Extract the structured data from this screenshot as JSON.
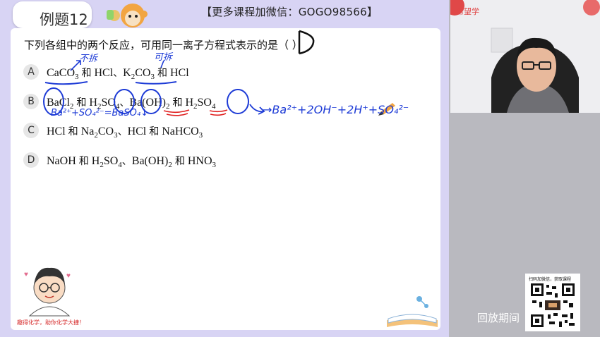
{
  "slide": {
    "title": "例题12",
    "banner": "【更多课程加微信：GOGO98566】",
    "question": "下列各组中的两个反应，可用同一离子方程式表示的是（   ）",
    "answer_mark": "D",
    "slogan": "趣得化学，助你化学大捷！"
  },
  "options": [
    {
      "letter": "A"
    },
    {
      "letter": "B"
    },
    {
      "letter": "C"
    },
    {
      "letter": "D"
    }
  ],
  "annotations": {
    "not_split": "不拆",
    "can_split": "可拆",
    "eq_b1": "Ba²⁺+SO₄²⁻=BaSO₄↓",
    "eq_b2": "→Ba²⁺+2OH⁻+2H⁺+SO₄²⁻"
  },
  "sidebar": {
    "brand": "希望学",
    "qr_caption": "扫码加微信，获取课程",
    "replay": "回放期间"
  }
}
